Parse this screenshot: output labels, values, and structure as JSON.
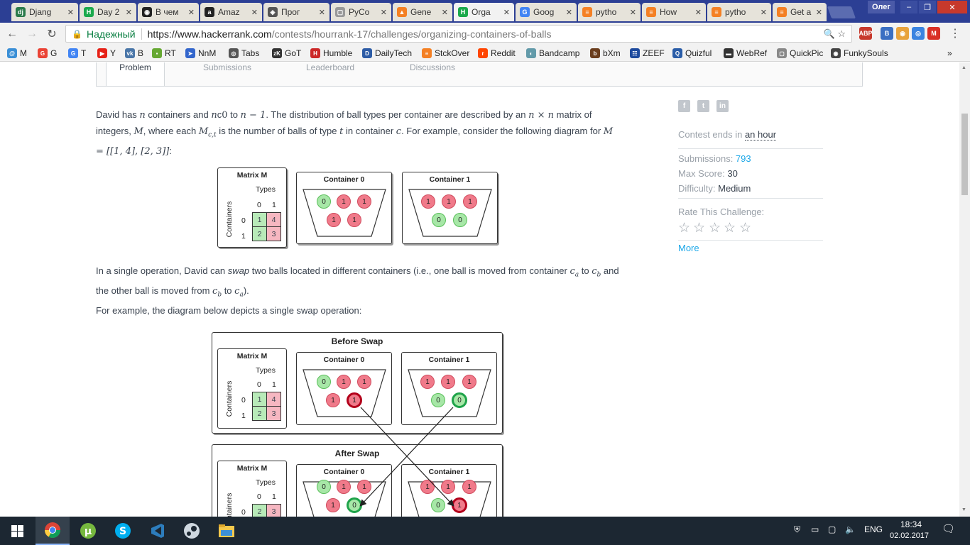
{
  "browser": {
    "tabs": [
      {
        "label": "Djang",
        "color": "#2b7a4b",
        "glyph": "dj"
      },
      {
        "label": "Day 2",
        "color": "#1ba94c",
        "glyph": "H"
      },
      {
        "label": "В чем",
        "color": "#222222",
        "glyph": "◉"
      },
      {
        "label": "Amaz",
        "color": "#222222",
        "glyph": "a"
      },
      {
        "label": "Прог",
        "color": "#555555",
        "glyph": "◈"
      },
      {
        "label": "PyCo",
        "color": "#999999",
        "glyph": "▢"
      },
      {
        "label": "Gene",
        "color": "#f48024",
        "glyph": "▲"
      },
      {
        "label": "Orga",
        "color": "#1ba94c",
        "glyph": "H"
      },
      {
        "label": "Goog",
        "color": "#4285f4",
        "glyph": "G"
      },
      {
        "label": "pytho",
        "color": "#f48024",
        "glyph": "≡"
      },
      {
        "label": "How",
        "color": "#f48024",
        "glyph": "≡"
      },
      {
        "label": "pytho",
        "color": "#f48024",
        "glyph": "≡"
      },
      {
        "label": "Get a",
        "color": "#f48024",
        "glyph": "≡"
      }
    ],
    "user_label": "Олег",
    "secure_label": "Надежный",
    "url_domain": "https://www.hackerrank.com",
    "url_path": "/contests/hourrank-17/challenges/organizing-containers-of-balls",
    "extensions": [
      {
        "label": "ABP",
        "color": "#c7392c"
      },
      {
        "label": "B",
        "color": "#3b6fc2"
      },
      {
        "label": "◉",
        "color": "#e8a33d"
      },
      {
        "label": "◎",
        "color": "#3b84e0"
      },
      {
        "label": "M",
        "color": "#d93025"
      }
    ],
    "bookmarks": [
      {
        "label": "M",
        "color": "#3b8fd6",
        "glyph": "@"
      },
      {
        "label": "G",
        "color": "#ea4335",
        "glyph": "G"
      },
      {
        "label": "T",
        "color": "#4285f4",
        "glyph": "G"
      },
      {
        "label": "Y",
        "color": "#e62117",
        "glyph": "▶"
      },
      {
        "label": "B",
        "color": "#4a76a8",
        "glyph": "vk"
      },
      {
        "label": "RT",
        "color": "#66a832",
        "glyph": "▪"
      },
      {
        "label": "NnM",
        "color": "#3366cc",
        "glyph": "➤"
      },
      {
        "label": "Tabs",
        "color": "#555555",
        "glyph": "◎"
      },
      {
        "label": "GoT",
        "color": "#333333",
        "glyph": "zK"
      },
      {
        "label": "Humble",
        "color": "#cc2929",
        "glyph": "H"
      },
      {
        "label": "DailyTech",
        "color": "#2d5ca6",
        "glyph": "D"
      },
      {
        "label": "StckOver",
        "color": "#f48024",
        "glyph": "≡"
      },
      {
        "label": "Reddit",
        "color": "#ff4500",
        "glyph": "r"
      },
      {
        "label": "Bandcamp",
        "color": "#629aa9",
        "glyph": "◐"
      },
      {
        "label": "bXm",
        "color": "#6b3e1e",
        "glyph": "b"
      },
      {
        "label": "ZEEF",
        "color": "#1e4b9e",
        "glyph": "☷"
      },
      {
        "label": "Quizful",
        "color": "#2a5da8",
        "glyph": "Q"
      },
      {
        "label": "WebRef",
        "color": "#333333",
        "glyph": "▬"
      },
      {
        "label": "QuickPic",
        "color": "#888888",
        "glyph": "▢"
      },
      {
        "label": "FunkySouls",
        "color": "#444444",
        "glyph": "◉"
      }
    ],
    "overflow": "»"
  },
  "page": {
    "tabs": [
      "Problem",
      "Submissions",
      "Leaderboard",
      "Discussions"
    ],
    "p1": {
      "a": "David has ",
      "n1": "n",
      "b": " containers and ",
      "n2": "n",
      "c": "c",
      "z": "0",
      "d": " to ",
      "nm1": "n − 1",
      "e": ". The distribution of ball types per container are described by an ",
      "nxn": "n × n",
      "f": " matrix of integers, ",
      "M": "M",
      "g": ", where each ",
      "Mct": "M",
      "Msub": "c,t",
      "h": " is the number of balls of type ",
      "t": "t",
      "i": " in container ",
      "j": ". For example, consider the following diagram for ",
      "Meq": "M = [[1, 4], [2, 3]]",
      "k": ":"
    },
    "p2": {
      "a": "In a single operation, David can ",
      "swap": "swap",
      "b": " two balls located in different containers (i.e., one ball is moved from container ",
      "ca": "c",
      "sa": "a",
      "c": " to ",
      "cb": "c",
      "sb": "b",
      "d": " and the other ball is moved from ",
      "cb2": "c",
      "sb2": "b",
      "e": " to ",
      "ca2": "c",
      "sa2": "a",
      "f": ")."
    },
    "p3": "For example, the diagram below depicts a single swap operation:",
    "diagram": {
      "matrix_title": "Matrix M",
      "types": "Types",
      "containers": "Containers",
      "col0": "0",
      "col1": "1",
      "row0": "0",
      "row1": "1",
      "container0": "Container 0",
      "container1": "Container 1",
      "before": "Before Swap",
      "after": "After Swap",
      "m1": [
        "1",
        "4",
        "2",
        "3"
      ],
      "m3": [
        "2",
        "3"
      ],
      "one": "1",
      "zero": "0"
    }
  },
  "sidebar": {
    "contest_label": "Contest ends in ",
    "contest_value": "an hour",
    "submissions_label": "Submissions: ",
    "submissions_value": "793",
    "max_label": "Max Score: ",
    "max_value": "30",
    "difficulty_label": "Difficulty: ",
    "difficulty_value": "Medium",
    "rate_label": "Rate This Challenge:",
    "more": "More",
    "social": [
      "f",
      "t",
      "in"
    ]
  },
  "taskbar": {
    "lang": "ENG",
    "time": "18:34",
    "date": "02.02.2017"
  }
}
